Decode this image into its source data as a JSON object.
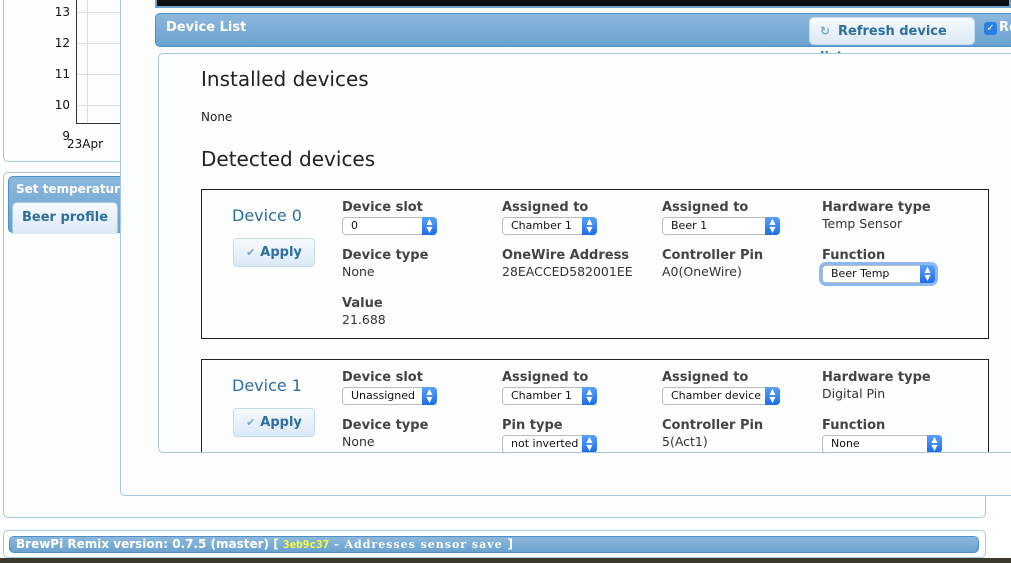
{
  "chart": {
    "y_ticks": [
      "13",
      "12",
      "11",
      "10",
      "9"
    ],
    "x_tick": "23Apr"
  },
  "set_temperature": {
    "title": "Set temperature",
    "tabs": [
      {
        "label": "Beer profile"
      }
    ]
  },
  "dialog": {
    "title": "Device List",
    "refresh_label": "Refresh device list",
    "refresh_icon": "refresh-icon",
    "auto_refresh_checked": true,
    "auto_refresh_label": "Re",
    "installed_heading": "Installed devices",
    "installed_value": "None",
    "detected_heading": "Detected devices",
    "apply_label": "Apply",
    "devices": [
      {
        "name": "Device 0",
        "device_slot_label": "Device slot",
        "device_slot": "0",
        "assigned_to_label": "Assigned to",
        "assigned_chamber": "Chamber 1",
        "assigned_to_2_label": "Assigned to",
        "assigned_beer": "Beer 1",
        "hardware_type_label": "Hardware type",
        "hardware_type": "Temp Sensor",
        "device_type_label": "Device type",
        "device_type": "None",
        "onewire_label": "OneWire Address",
        "onewire_address": "28EACCED582001EE",
        "controller_pin_label": "Controller Pin",
        "controller_pin": "A0(OneWire)",
        "function_label": "Function",
        "function": "Beer Temp",
        "value_label": "Value",
        "value": "21.688"
      },
      {
        "name": "Device 1",
        "device_slot_label": "Device slot",
        "device_slot": "Unassigned",
        "assigned_to_label": "Assigned to",
        "assigned_chamber": "Chamber 1",
        "assigned_to_2_label": "Assigned to",
        "assigned_beer": "Chamber device",
        "hardware_type_label": "Hardware type",
        "hardware_type": "Digital Pin",
        "device_type_label": "Device type",
        "device_type": "None",
        "pin_type_label": "Pin type",
        "pin_type": "not inverted",
        "controller_pin_label": "Controller Pin",
        "controller_pin": "5(Act1)",
        "function_label": "Function",
        "function": "None"
      }
    ]
  },
  "footer": {
    "version_text": "BrewPi Remix version: 0.7.5 (master) [ ",
    "commit_hash": "3eb9c37",
    "commit_message": " - Addresses sensor save ",
    "close_bracket": "]"
  },
  "colors": {
    "accent": "#2e6e9e",
    "header_blue": "#6aa2cf",
    "commit_hash": "#ffff33"
  }
}
